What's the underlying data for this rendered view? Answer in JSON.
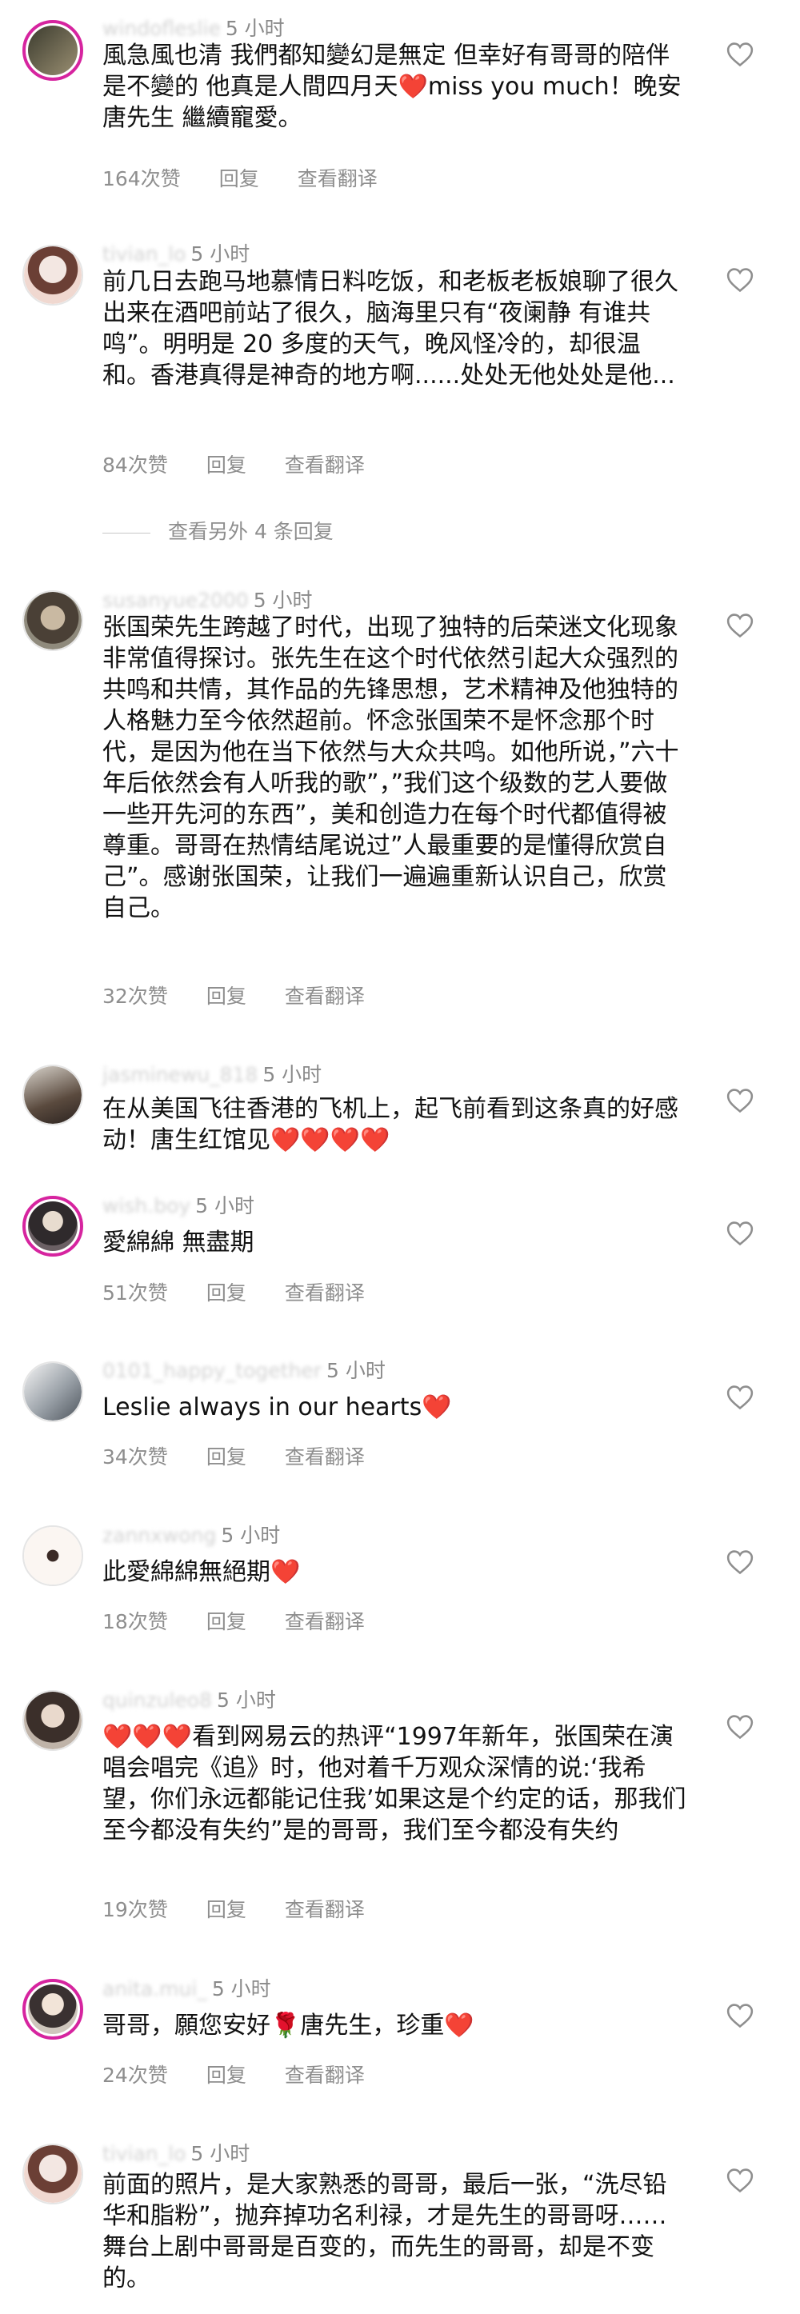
{
  "like_label": "次赞",
  "reply_label": "回复",
  "translate_label": "查看翻译",
  "heart_glyph": "❤️",
  "rose_glyph": "🌹",
  "heart_color": "#ed1c24",
  "icons": {
    "like": "heart-outline-icon",
    "avatar": "profile-picture"
  },
  "more_replies": "查看另外 4 条回复",
  "comments": [
    {
      "username": "windofleslie",
      "time": "5 小时",
      "text_a": "風急風也清 我們都知變幻是無定 但幸好有哥哥的陪伴是不變的 他真是人間四月天",
      "text_b": "miss you much！晚安唐先生 繼續寵愛。",
      "likes": "164"
    },
    {
      "username": "tivian_lo",
      "time": "5 小时",
      "text": "前几日去跑马地慕情日料吃饭，和老板老板娘聊了很久 出来在酒吧前站了很久，脑海里只有“夜阑静 有谁共鸣”。明明是 20 多度的天气，晚风怪冷的，却很温和。香港真得是神奇的地方啊......处处无他处处是他...",
      "likes": "84"
    },
    {
      "username": "susanyue2000",
      "time": "5 小时",
      "text": "张国荣先生跨越了时代，出现了独特的后荣迷文化现象非常值得探讨。张先生在这个时代依然引起大众强烈的共鸣和共情，其作品的先锋思想，艺术精神及他独特的人格魅力至今依然超前。怀念张国荣不是怀念那个时代，是因为他在当下依然与大众共鸣。如他所说，”六十年后依然会有人听我的歌”，”我们这个级数的艺人要做一些开先河的东西”，美和创造力在每个时代都值得被尊重。哥哥在热情结尾说过”人最重要的是懂得欣赏自己”。感谢张国荣，让我们一遍遍重新认识自己，欣赏自己。",
      "likes": "32"
    },
    {
      "username": "jasminewu_818",
      "time": "5 小时",
      "text": "在从美国飞往香港的飞机上，起飞前看到这条真的好感动！唐生红馆见"
    },
    {
      "username": "wish.boy",
      "time": "5 小时",
      "text": "愛綿綿 無盡期",
      "likes": "51"
    },
    {
      "username": "0101_happy_together",
      "time": "5 小时",
      "text": "Leslie always in our hearts",
      "likes": "34"
    },
    {
      "username": "zannxwong",
      "time": "5 小时",
      "text": "此愛綿綿無絕期",
      "likes": "18"
    },
    {
      "username": "quinzuleo8",
      "time": "5 小时",
      "text": "看到网易云的热评“1997年新年，张国荣在演唱会唱完《追》时，他对着千万观众深情的说:‘我希望，你们永远都能记住我’如果这是个约定的话，那我们至今都没有失约”是的哥哥，我们至今都没有失约",
      "likes": "19"
    },
    {
      "username": "anita.mui_",
      "time": "5 小时",
      "text_a": "哥哥，願您安好",
      "text_b": "唐先生，珍重",
      "likes": "24"
    },
    {
      "username": "tivian_lo",
      "time": "5 小时",
      "text": "前面的照片，是大家熟悉的哥哥，最后一张，“洗尽铅华和脂粉”，抛弃掉功名利禄，才是先生的哥哥呀……舞台上剧中哥哥是百变的，而先生的哥哥，却是不变的。"
    }
  ]
}
